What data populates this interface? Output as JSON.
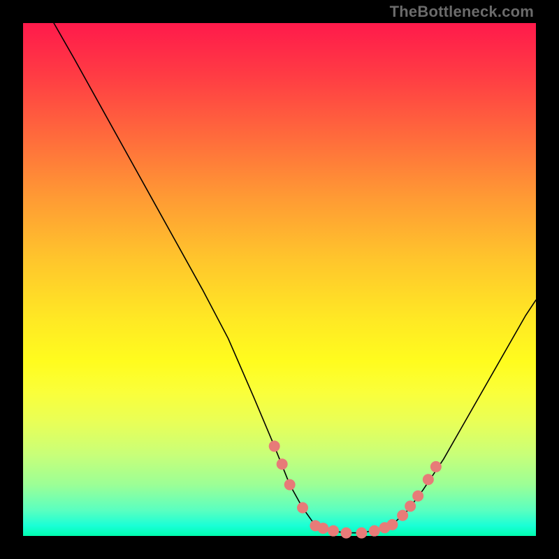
{
  "watermark": "TheBottleneck.com",
  "chart_data": {
    "type": "line",
    "title": "",
    "xlabel": "",
    "ylabel": "",
    "xlim": [
      0,
      100
    ],
    "ylim": [
      0,
      100
    ],
    "grid": false,
    "legend": "none",
    "series": [
      {
        "name": "curve-left",
        "x": [
          6,
          10,
          15,
          20,
          25,
          30,
          35,
          40,
          45,
          49,
          52,
          54.5,
          57
        ],
        "y": [
          100,
          93,
          84,
          75,
          66,
          57,
          48,
          38.5,
          27,
          17.5,
          10,
          5.5,
          2
        ]
      },
      {
        "name": "curve-bottom",
        "x": [
          57,
          60,
          63,
          66,
          69,
          72
        ],
        "y": [
          2,
          1,
          0.6,
          0.6,
          1.2,
          2.2
        ]
      },
      {
        "name": "curve-right",
        "x": [
          72,
          75,
          78,
          82,
          86,
          90,
          94,
          98,
          100
        ],
        "y": [
          2.2,
          5,
          9,
          15,
          22,
          29,
          36,
          43,
          46
        ]
      }
    ],
    "markers": {
      "name": "dotted-points",
      "color": "#e77b78",
      "radius": 8,
      "points": [
        {
          "x": 49,
          "y": 17.5
        },
        {
          "x": 50.5,
          "y": 14
        },
        {
          "x": 52,
          "y": 10
        },
        {
          "x": 54.5,
          "y": 5.5
        },
        {
          "x": 57,
          "y": 2
        },
        {
          "x": 58.5,
          "y": 1.5
        },
        {
          "x": 60.5,
          "y": 1
        },
        {
          "x": 63,
          "y": 0.6
        },
        {
          "x": 66,
          "y": 0.6
        },
        {
          "x": 68.5,
          "y": 1
        },
        {
          "x": 70.5,
          "y": 1.6
        },
        {
          "x": 72,
          "y": 2.2
        },
        {
          "x": 74,
          "y": 4
        },
        {
          "x": 75.5,
          "y": 5.8
        },
        {
          "x": 77,
          "y": 7.8
        },
        {
          "x": 79,
          "y": 11
        },
        {
          "x": 80.5,
          "y": 13.5
        }
      ]
    }
  }
}
